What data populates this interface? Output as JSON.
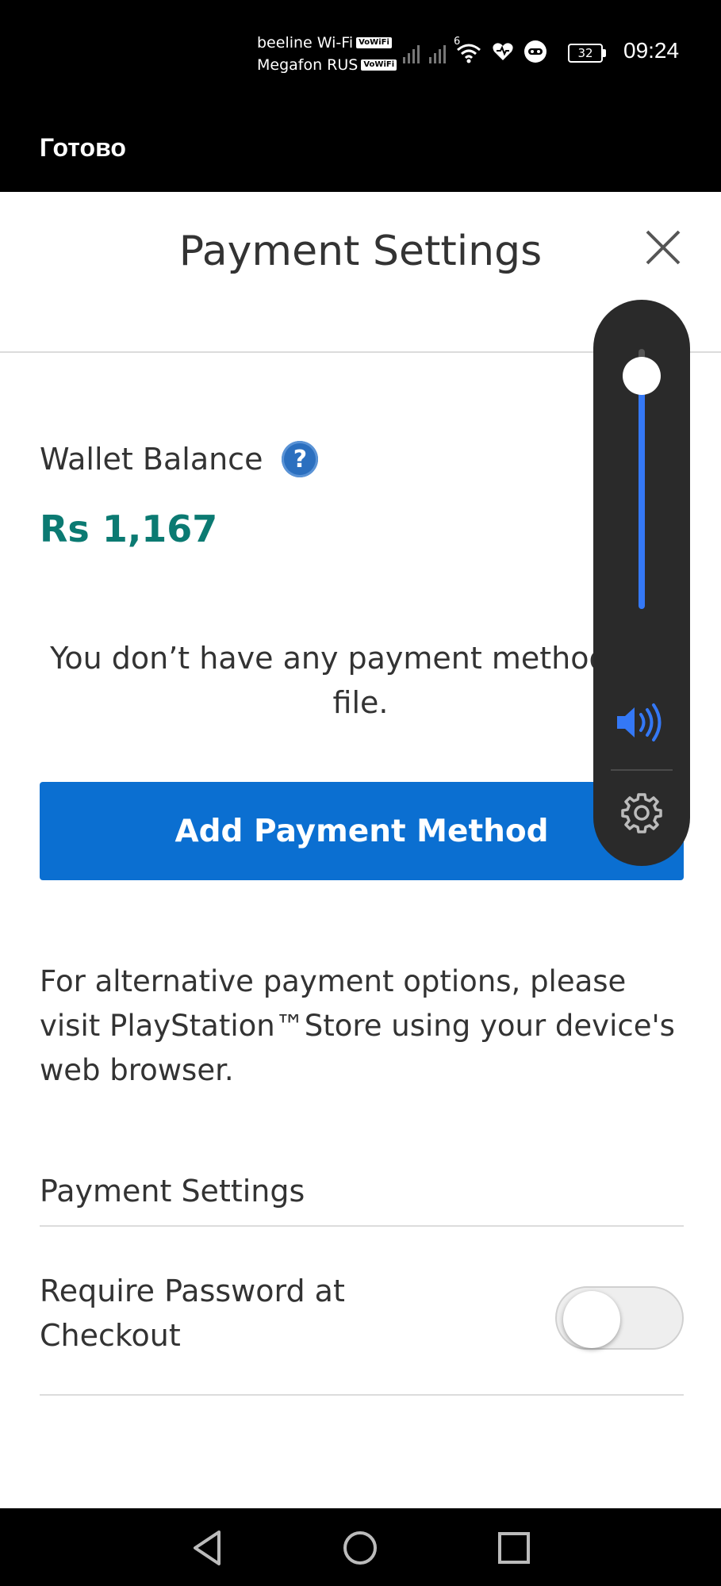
{
  "status_bar": {
    "carrier1": "beeline Wi-Fi",
    "carrier2": "Megafon RUS",
    "vowifi_badge": "VoWiFi",
    "network_type": "6",
    "battery": "32",
    "time": "09:24",
    "icons": [
      "signal-icon",
      "signal-icon",
      "wifi-icon",
      "heart-icon",
      "assistant-icon",
      "battery-icon"
    ]
  },
  "top_bar": {
    "done_label": "Готово"
  },
  "header": {
    "title": "Payment Settings",
    "close_icon": "close-icon"
  },
  "wallet": {
    "label": "Wallet Balance",
    "help_glyph": "?",
    "amount": "Rs 1,167",
    "amount_color": "#0b7a72"
  },
  "payment_methods": {
    "empty_message": "You don’t have any payment methods on file.",
    "add_button_label": "Add Payment Method",
    "button_color": "#0b6fd1"
  },
  "alternative_text": "For alternative payment options, please visit PlayStation™Store using your device's web browser.",
  "settings": {
    "section_heading": "Payment Settings",
    "require_password_label": "Require Password at Checkout",
    "require_password_enabled": false
  },
  "volume_overlay": {
    "level_percent": 100,
    "accent_color": "#3478f6",
    "speaker_icon": "speaker-icon",
    "settings_icon": "gear-icon"
  },
  "nav_bar": {
    "icons": [
      "back-icon",
      "home-icon",
      "recents-icon"
    ]
  }
}
